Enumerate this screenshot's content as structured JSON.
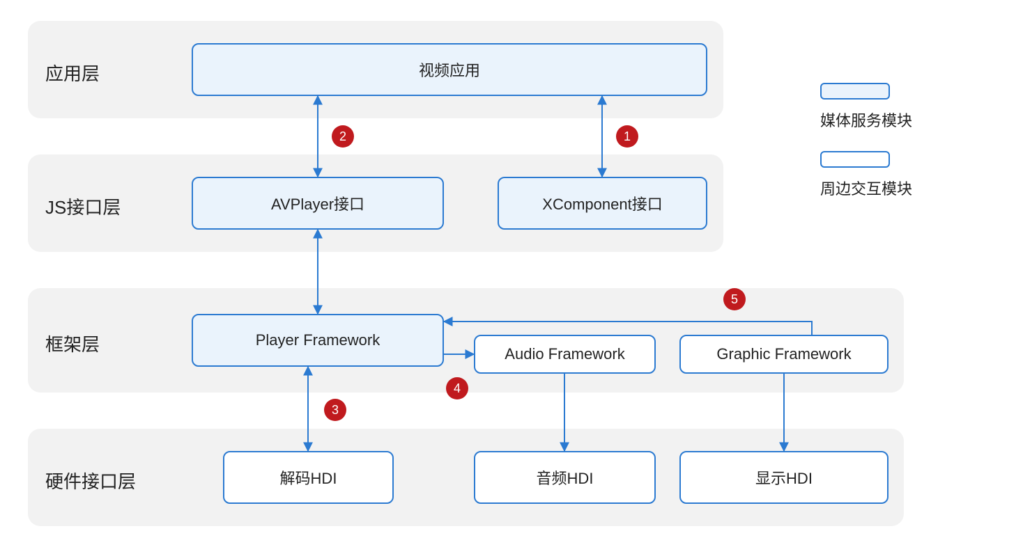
{
  "layers": {
    "app": "应用层",
    "js": "JS接口层",
    "framework": "框架层",
    "hardware": "硬件接口层"
  },
  "nodes": {
    "video_app": "视频应用",
    "avplayer": "AVPlayer接口",
    "xcomponent": "XComponent接口",
    "player_fw": "Player Framework",
    "audio_fw": "Audio Framework",
    "graphic_fw": "Graphic Framework",
    "decode_hdi": "解码HDI",
    "audio_hdi": "音频HDI",
    "display_hdi": "显示HDI"
  },
  "badges": {
    "b1": "1",
    "b2": "2",
    "b3": "3",
    "b4": "4",
    "b5": "5"
  },
  "legend": {
    "media": "媒体服务模块",
    "peripheral": "周边交互模块"
  }
}
